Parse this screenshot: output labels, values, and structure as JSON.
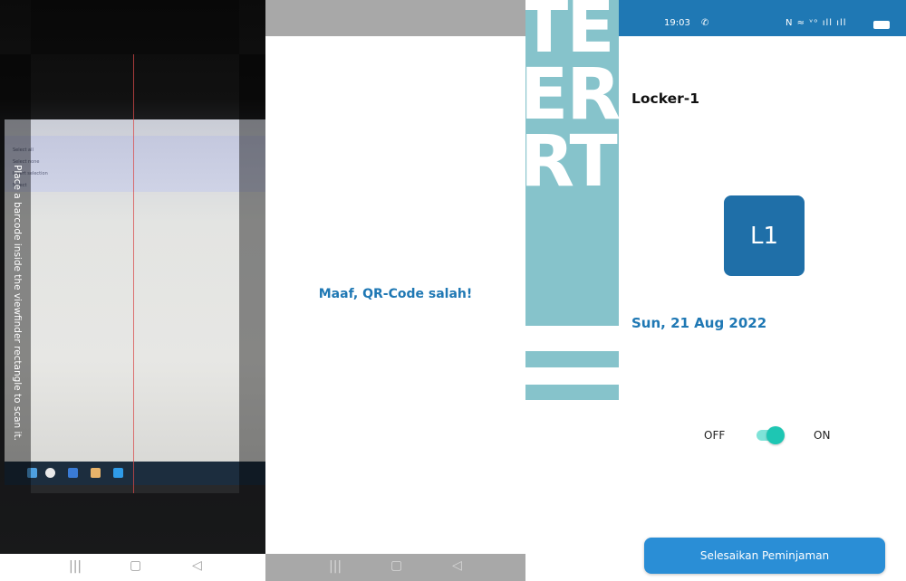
{
  "scanner_panel": {
    "hint_text": "Place a barcode inside the viewfinder rectangle to scan it.",
    "captured_screen_lines": [
      "Select all",
      "Select none",
      "Invert selection",
      "Select"
    ],
    "nav": {
      "recent": "|||",
      "home": "▢",
      "back": "◁"
    }
  },
  "error_panel": {
    "message": "Maaf, QR-Code salah!",
    "nav": {
      "recent": "|||",
      "home": "▢",
      "back": "◁"
    }
  },
  "watermark": {
    "lines": [
      "TE",
      "ER",
      "RT"
    ]
  },
  "locker_panel": {
    "status_bar": {
      "time": "19:03",
      "whatsapp_icon": "✆",
      "system_icons": "N ≈ ᵛᵒ ıll ıll"
    },
    "title": "Locker-1",
    "badge": "L1",
    "date": "Sun, 21 Aug 2022",
    "toggle": {
      "off_label": "OFF",
      "on_label": "ON",
      "state": "on"
    },
    "finish_button": "Selesaikan Peminjaman"
  },
  "colors": {
    "primary_blue": "#1f78b4",
    "badge_blue": "#1f6fa8",
    "toggle_teal": "#1ec6b3",
    "button_blue": "#2a8ed6",
    "watermark_teal": "#86c3cb",
    "gray_bar": "#a8a8a8"
  }
}
